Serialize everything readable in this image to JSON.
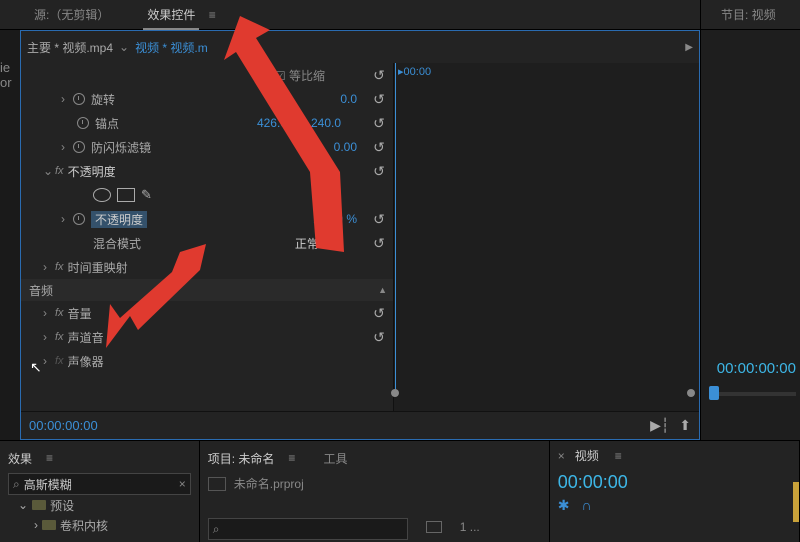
{
  "tabs": {
    "source": "源:（无剪辑）",
    "effect_controls": "效果控件",
    "program": "节目: 视频"
  },
  "header": {
    "master": "主要 * 视频.mp4",
    "sequence": "视频 * 视频.m",
    "playhead": "00:00"
  },
  "rows": {
    "scale_check": "等比缩",
    "rotation": "旋转",
    "rotation_val": "0.0",
    "anchor": "锚点",
    "anchor_x": "426.0",
    "anchor_y": "240.0",
    "flicker": "防闪烁滤镜",
    "flicker_val": "0.00",
    "opacity_group": "不透明度",
    "opacity": "不透明度",
    "opacity_val": "100.0 %",
    "blend": "混合模式",
    "blend_val": "正常",
    "time_remap": "时间重映射",
    "audio_hdr": "音频",
    "volume": "音量",
    "ch_volume": "声道音",
    "panner": "声像器"
  },
  "foot": {
    "timecode": "00:00:00:00"
  },
  "rcol": {
    "time": "00:00:00:00"
  },
  "effects_panel": {
    "title": "效果",
    "search": "高斯模糊",
    "preset": "预设",
    "kernel": "卷积内核"
  },
  "project_panel": {
    "title": "项目: 未命名",
    "tools_tab": "工具",
    "file": "未命名.prproj",
    "count": "1 ..."
  },
  "sequence_panel": {
    "title": "视频",
    "time": "00:00:00"
  }
}
